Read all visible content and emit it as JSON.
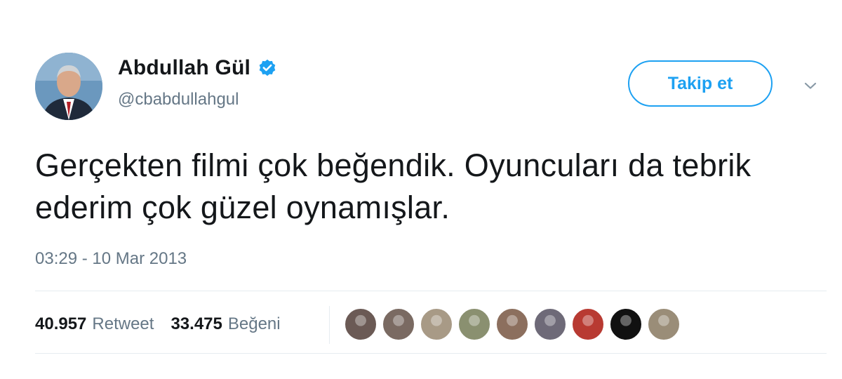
{
  "author": {
    "display_name": "Abdullah Gül",
    "handle": "@cbabdullahgul",
    "verified": true
  },
  "follow_label": "Takip et",
  "tweet_text": "Gerçekten filmi çok beğendik. Oyuncuları da tebrik ederim çok güzel oynamışlar.",
  "timestamp": "03:29 - 10 Mar 2013",
  "stats": {
    "retweet_count": "40.957",
    "retweet_label": "Retweet",
    "like_count": "33.475",
    "like_label": "Beğeni"
  },
  "liker_avatars": [
    {
      "color": "#6b5a55"
    },
    {
      "color": "#7a6a62"
    },
    {
      "color": "#a89a86"
    },
    {
      "color": "#8a9070"
    },
    {
      "color": "#8c6f5e"
    },
    {
      "color": "#6e6a78"
    },
    {
      "color": "#b83a32"
    },
    {
      "color": "#111111"
    },
    {
      "color": "#9a8d78"
    }
  ],
  "colors": {
    "accent": "#1da1f2",
    "verified_badge": "#1da1f2",
    "secondary_text": "#657786"
  }
}
